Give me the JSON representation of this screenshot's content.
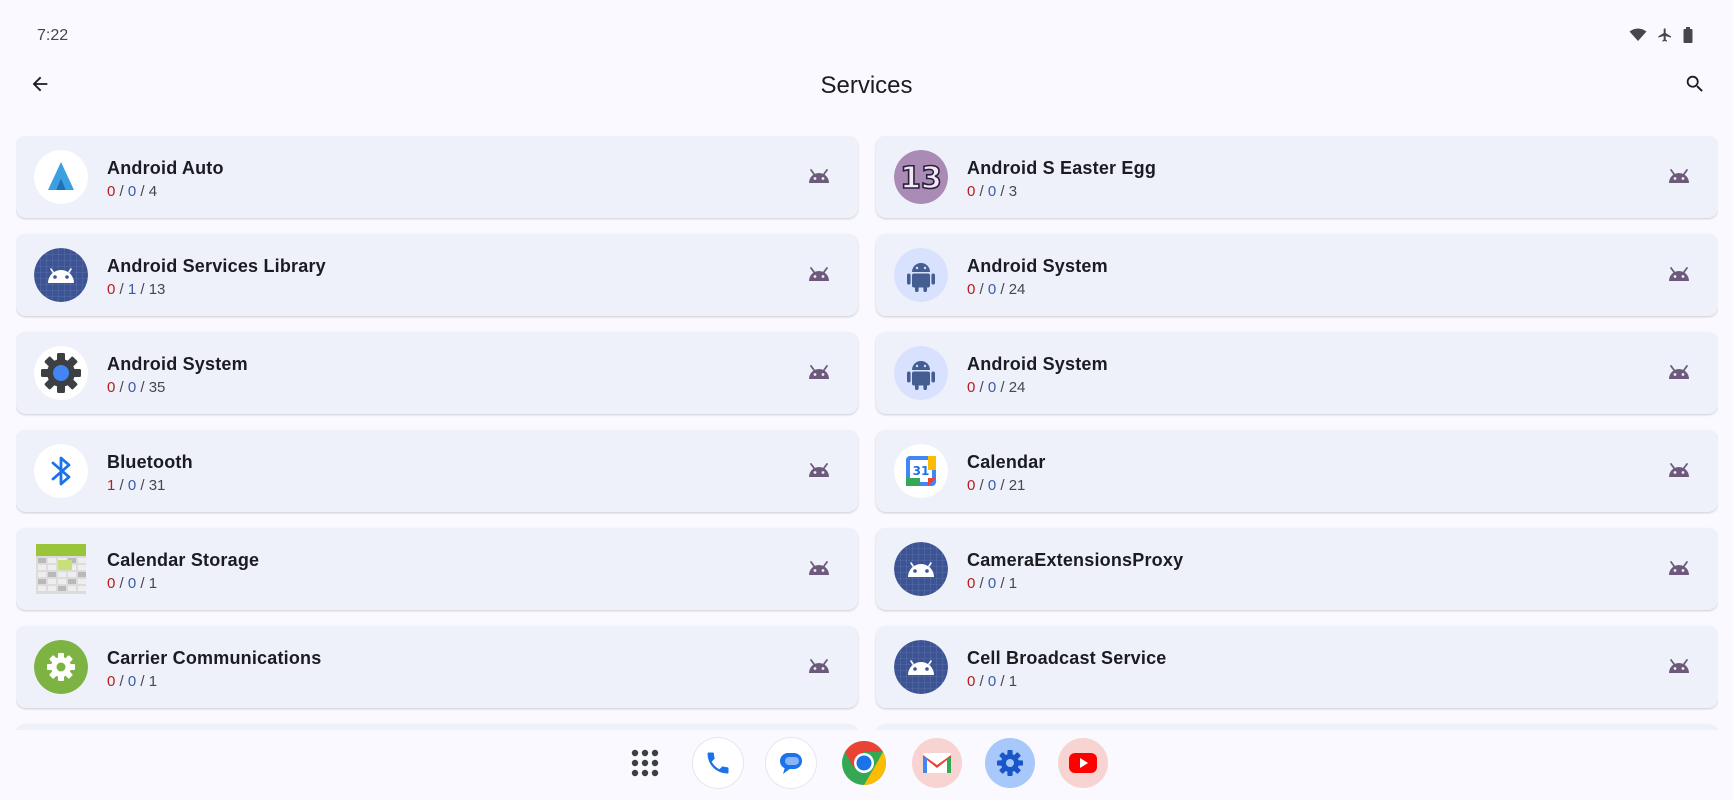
{
  "status": {
    "time": "7:22",
    "icons": [
      "wifi-icon",
      "airplane-icon",
      "battery-icon"
    ]
  },
  "app_bar": {
    "title": "Services",
    "back_icon": "arrow-back-icon",
    "search_icon": "search-icon"
  },
  "colors": {
    "red": "#ba1a1a",
    "blue": "#3a5ba9",
    "card": "#eef1fa",
    "droid": "#6d5a7a"
  },
  "items": [
    {
      "name": "Android Auto",
      "a": "0",
      "b": "0",
      "c": "4",
      "icon": "android-auto-icon"
    },
    {
      "name": "Android S Easter Egg",
      "a": "0",
      "b": "0",
      "c": "3",
      "icon": "easter-egg-13-icon"
    },
    {
      "name": "Android Services Library",
      "a": "0",
      "b": "1",
      "c": "13",
      "icon": "android-default-icon"
    },
    {
      "name": "Android System",
      "a": "0",
      "b": "0",
      "c": "24",
      "icon": "android-robot-icon"
    },
    {
      "name": "Android System",
      "a": "0",
      "b": "0",
      "c": "35",
      "icon": "settings-gear-icon"
    },
    {
      "name": "Android System",
      "a": "0",
      "b": "0",
      "c": "24",
      "icon": "android-robot-icon"
    },
    {
      "name": "Bluetooth",
      "a": "1",
      "b": "0",
      "c": "31",
      "icon": "bluetooth-icon"
    },
    {
      "name": "Calendar",
      "a": "0",
      "b": "0",
      "c": "21",
      "icon": "calendar-icon"
    },
    {
      "name": "Calendar Storage",
      "a": "0",
      "b": "0",
      "c": "1",
      "icon": "calendar-storage-icon"
    },
    {
      "name": "CameraExtensionsProxy",
      "a": "0",
      "b": "0",
      "c": "1",
      "icon": "android-default-icon"
    },
    {
      "name": "Carrier Communications",
      "a": "0",
      "b": "0",
      "c": "1",
      "icon": "carrier-gear-icon"
    },
    {
      "name": "Cell Broadcast Service",
      "a": "0",
      "b": "0",
      "c": "1",
      "icon": "android-default-icon"
    },
    {
      "name": "",
      "a": "",
      "b": "",
      "c": "",
      "icon": "android-default-icon"
    },
    {
      "name": "",
      "a": "",
      "b": "",
      "c": "",
      "icon": "android-default-icon"
    }
  ],
  "dock": [
    "app-drawer-icon",
    "phone-icon",
    "messages-icon",
    "chrome-icon",
    "gmail-icon",
    "settings-icon",
    "youtube-icon"
  ]
}
